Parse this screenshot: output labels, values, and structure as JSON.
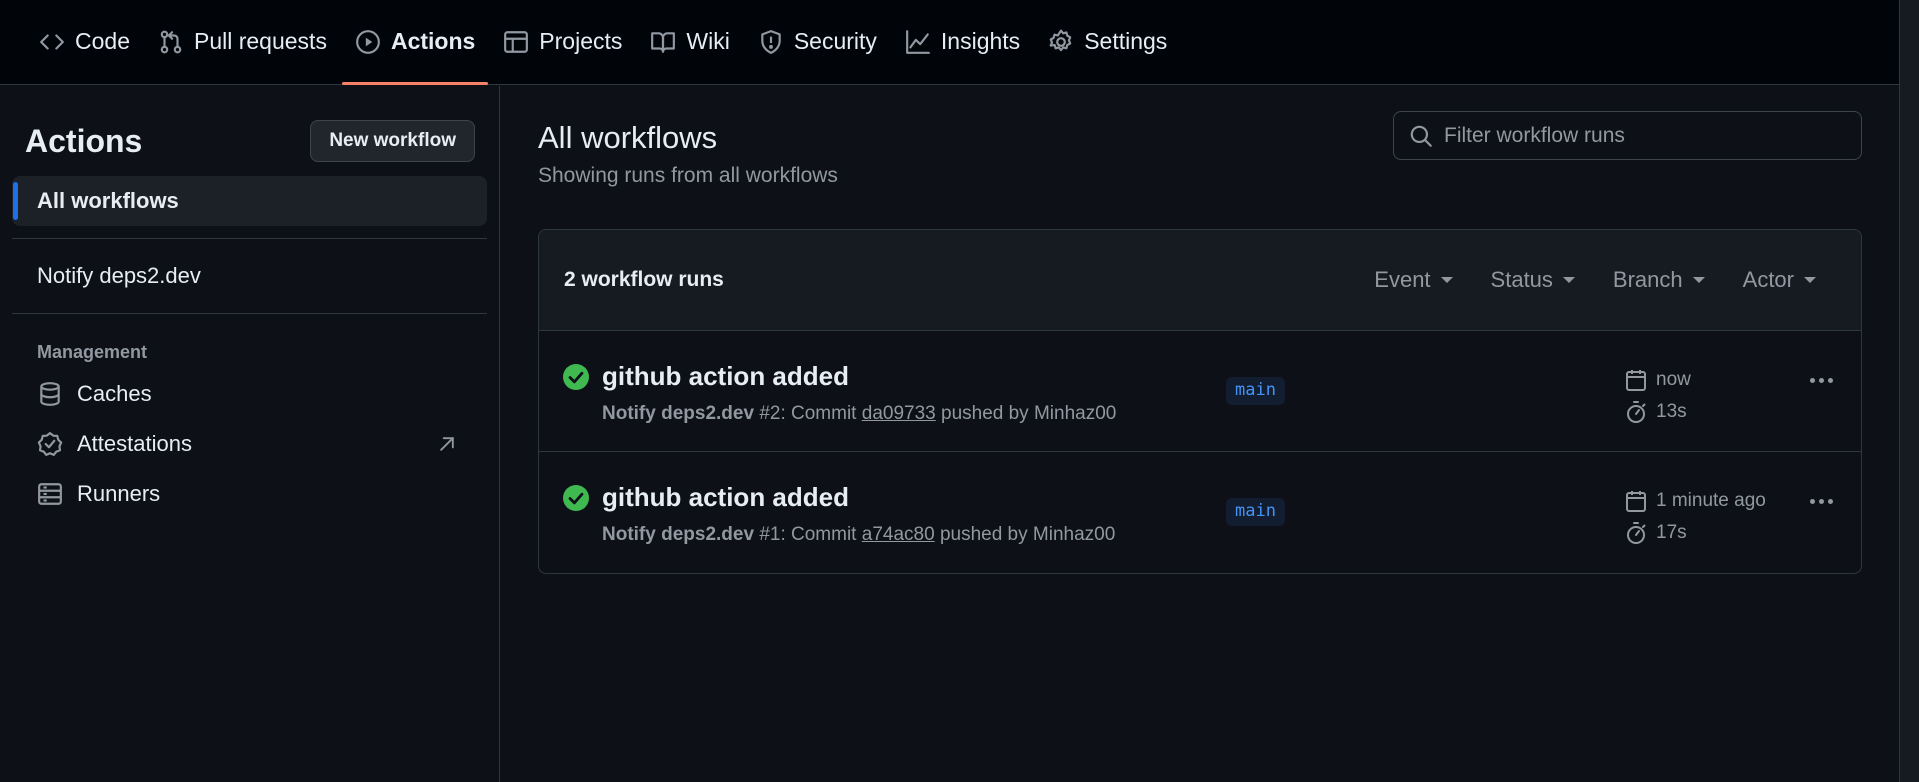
{
  "nav": {
    "tabs": [
      {
        "label": "Code",
        "icon": "code-icon"
      },
      {
        "label": "Pull requests",
        "icon": "pull-request-icon"
      },
      {
        "label": "Actions",
        "icon": "play-icon",
        "active": true
      },
      {
        "label": "Projects",
        "icon": "table-icon"
      },
      {
        "label": "Wiki",
        "icon": "book-icon"
      },
      {
        "label": "Security",
        "icon": "shield-icon"
      },
      {
        "label": "Insights",
        "icon": "graph-icon"
      },
      {
        "label": "Settings",
        "icon": "gear-icon"
      }
    ]
  },
  "sidebar": {
    "title": "Actions",
    "new_workflow_label": "New workflow",
    "all_workflows": "All workflows",
    "workflow": "Notify deps2.dev",
    "management_label": "Management",
    "management_items": [
      {
        "label": "Caches",
        "icon": "database-icon"
      },
      {
        "label": "Attestations",
        "icon": "verified-icon"
      },
      {
        "label": "Runners",
        "icon": "server-icon"
      }
    ]
  },
  "main": {
    "title": "All workflows",
    "subtitle": "Showing runs from all workflows",
    "filter_placeholder": "Filter workflow runs",
    "runs_count": "2 workflow runs",
    "filters": [
      "Event",
      "Status",
      "Branch",
      "Actor"
    ],
    "runs": [
      {
        "title": "github action added",
        "workflow": "Notify deps2.dev",
        "run_text": "#2: Commit",
        "sha": "da09733",
        "pushed_by": "pushed by Minhaz00",
        "branch": "main",
        "when": "now",
        "duration": "13s",
        "status": "success"
      },
      {
        "title": "github action added",
        "workflow": "Notify deps2.dev",
        "run_text": "#1: Commit",
        "sha": "a74ac80",
        "pushed_by": "pushed by Minhaz00",
        "branch": "main",
        "when": "1 minute ago",
        "duration": "17s",
        "status": "success"
      }
    ]
  },
  "colors": {
    "background": "#0d1117",
    "nav_bg": "#010409",
    "accent_tab": "#f78166",
    "selected_bar": "#1f6feb",
    "success": "#3fb950",
    "branch_text": "#4493f8"
  }
}
